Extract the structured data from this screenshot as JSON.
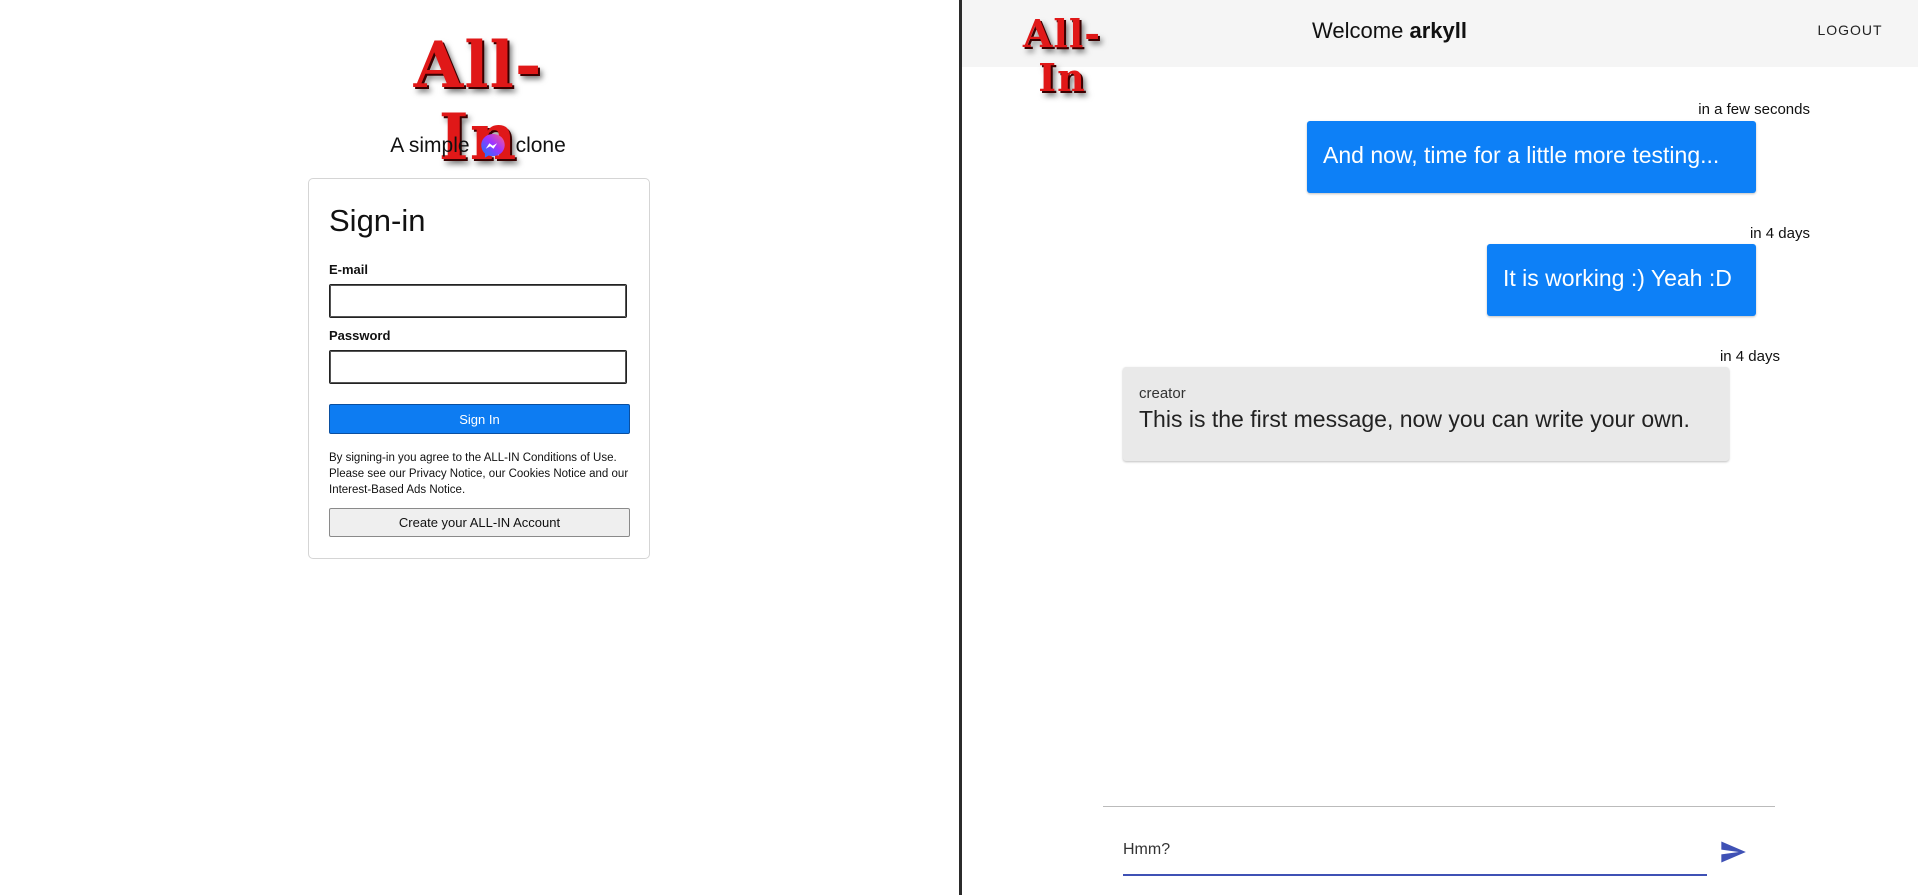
{
  "signin_page": {
    "logo": "All-In",
    "tagline": {
      "before": "A simple",
      "icon": "messenger-icon",
      "after": "clone"
    },
    "card": {
      "title": "Sign-in",
      "email_label": "E-mail",
      "email_value": "",
      "password_label": "Password",
      "password_value": "",
      "signin_button": "Sign In",
      "terms_text": "By signing-in you agree to the ALL-IN Conditions of Use. Please see our Privacy Notice, our Cookies Notice and our Interest-Based Ads Notice.",
      "create_account_button": "Create your ALL-IN Account"
    }
  },
  "chat_page": {
    "header": {
      "logo": "All-In",
      "welcome_prefix": "Welcome",
      "username": "arkyll",
      "logout": "LOGOUT"
    },
    "messages": [
      {
        "time": "in a few seconds",
        "text": "And now, time for a little more testing...",
        "mine": true
      },
      {
        "time": "in 4 days",
        "text": "It is working :) Yeah :D",
        "mine": true
      },
      {
        "time": "in 4 days",
        "sender": "creator",
        "text": "This is the first message, now you can write your own.",
        "mine": false
      }
    ],
    "composer": {
      "value": "Hmm?",
      "send_icon": "send-icon"
    }
  },
  "colors": {
    "brand_red": "#e01818",
    "primary_blue": "#0d80f7",
    "input_underline": "#3f51b5",
    "other_bubble": "#e9e9e9"
  }
}
